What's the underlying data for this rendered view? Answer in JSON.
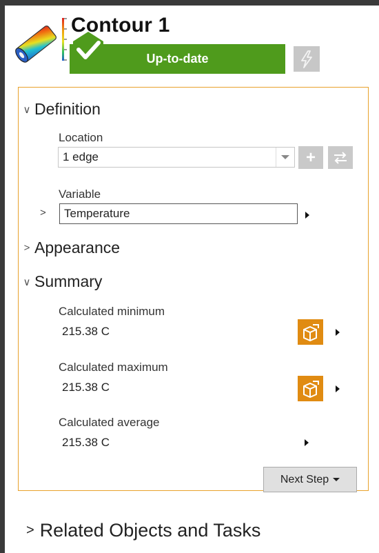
{
  "header": {
    "title": "Contour 1",
    "status_label": "Up-to-date",
    "status_color": "#4f9b1c",
    "icons": {
      "object": "contour-cylinder-icon",
      "status": "checkmark-icon",
      "update": "lightning-icon"
    }
  },
  "sections": {
    "definition": {
      "label": "Definition",
      "location_label": "Location",
      "location_value": "1 edge",
      "variable_label": "Variable",
      "variable_value": "Temperature"
    },
    "appearance": {
      "label": "Appearance"
    },
    "summary": {
      "label": "Summary",
      "items": [
        {
          "label": "Calculated minimum",
          "value": "215.38 C"
        },
        {
          "label": "Calculated maximum",
          "value": "215.38 C"
        },
        {
          "label": "Calculated average",
          "value": "215.38 C"
        }
      ]
    }
  },
  "next_step_label": "Next Step",
  "related_label": "Related Objects and Tasks",
  "accent_color": "#e8a12a"
}
